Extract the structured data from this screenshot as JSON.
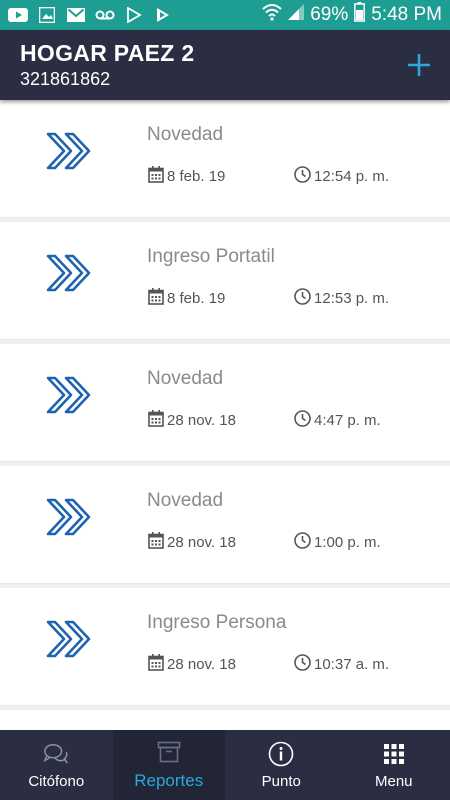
{
  "status_bar": {
    "battery": "69%",
    "time": "5:48 PM"
  },
  "header": {
    "title": "HOGAR PAEZ 2",
    "subtitle": "321861862"
  },
  "reports": [
    {
      "title": "Novedad",
      "date": "8 feb. 19",
      "time": "12:54 p. m."
    },
    {
      "title": "Ingreso Portatil",
      "date": "8 feb. 19",
      "time": "12:53 p. m."
    },
    {
      "title": "Novedad",
      "date": "28 nov. 18",
      "time": "4:47 p. m."
    },
    {
      "title": "Novedad",
      "date": "28 nov. 18",
      "time": "1:00 p. m."
    },
    {
      "title": "Ingreso Persona",
      "date": "28 nov. 18",
      "time": "10:37 a. m."
    }
  ],
  "tabs": [
    {
      "label": "Citófono",
      "icon": "chat-icon"
    },
    {
      "label": "Reportes",
      "icon": "archive-icon"
    },
    {
      "label": "Punto",
      "icon": "info-icon"
    },
    {
      "label": "Menu",
      "icon": "grid-icon"
    }
  ],
  "colors": {
    "status_bar": "#1e9e92",
    "header": "#2b2e42",
    "accent": "#29a9e0",
    "icon_blue": "#1e63b0"
  }
}
